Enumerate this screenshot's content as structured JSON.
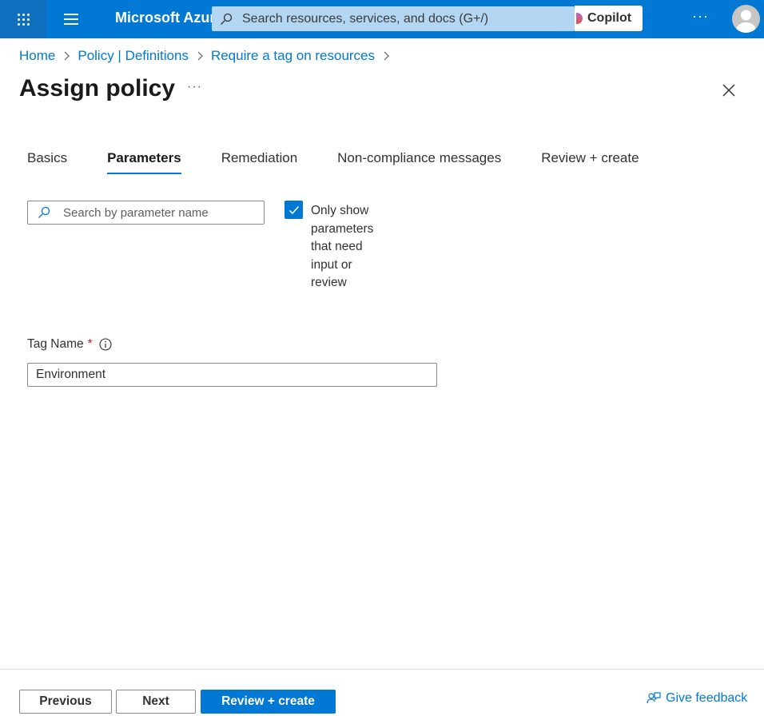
{
  "topbar": {
    "brand": "Microsoft Azure",
    "search_placeholder": "Search resources, services, and docs (G+/)",
    "copilot_label": "Copilot",
    "more_label": "···"
  },
  "breadcrumb": [
    "Home",
    "Policy | Definitions",
    "Require a tag on resources"
  ],
  "page": {
    "title": "Assign policy",
    "more_label": "···"
  },
  "tabs": [
    {
      "label": "Basics",
      "active": false
    },
    {
      "label": "Parameters",
      "active": true
    },
    {
      "label": "Remediation",
      "active": false
    },
    {
      "label": "Non-compliance messages",
      "active": false
    },
    {
      "label": "Review + create",
      "active": false
    }
  ],
  "parameters": {
    "search_placeholder": "Search by parameter name",
    "only_show_label": "Only show parameters that need input or review",
    "only_show_checked": true,
    "tag_name_label": "Tag Name",
    "required_marker": "*",
    "tag_name_value": "Environment"
  },
  "footer": {
    "previous_label": "Previous",
    "next_label": "Next",
    "review_create_label": "Review + create",
    "feedback_label": "Give feedback"
  },
  "colors": {
    "accent": "#0078d4",
    "topbar": "#0078d4",
    "required": "#a4262c"
  }
}
